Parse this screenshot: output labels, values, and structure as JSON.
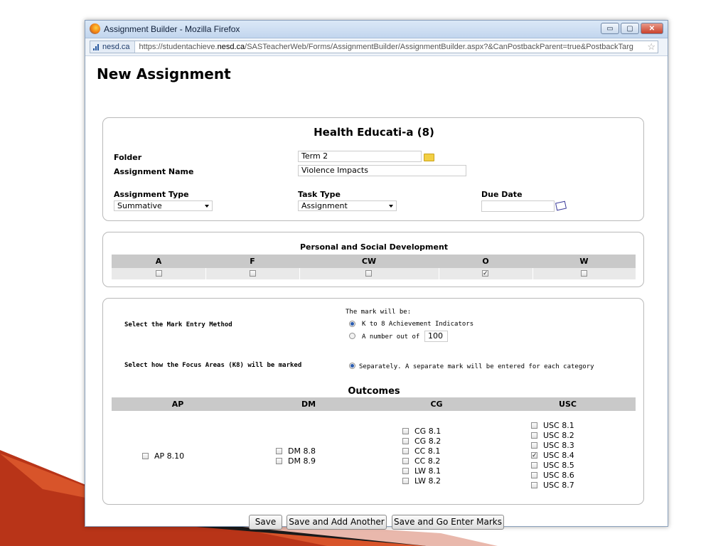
{
  "window": {
    "title": "Assignment Builder - Mozilla Firefox",
    "minimize_label": "▭",
    "maximize_label": "▢",
    "close_label": "✕"
  },
  "urlbar": {
    "site_identity": "nesd.ca",
    "url_prefix": "https://studentachieve.",
    "url_domain": "nesd.ca",
    "url_suffix": "/SASTeacherWeb/Forms/AssignmentBuilder/AssignmentBuilder.aspx?&CanPostbackParent=true&PostbackTarg"
  },
  "page": {
    "title": "New Assignment"
  },
  "details": {
    "course_title": "Health Educati-a (8)",
    "folder_label": "Folder",
    "folder_value": "Term 2",
    "assignment_name_label": "Assignment Name",
    "assignment_name_value": "Violence Impacts",
    "assignment_type_label": "Assignment Type",
    "assignment_type_value": "Summative",
    "task_type_label": "Task Type",
    "task_type_value": "Assignment",
    "due_date_label": "Due Date",
    "due_date_value": ""
  },
  "psd": {
    "title": "Personal and Social Development",
    "columns": [
      {
        "label": "A",
        "checked": false
      },
      {
        "label": "F",
        "checked": false
      },
      {
        "label": "CW",
        "checked": false
      },
      {
        "label": "O",
        "checked": true
      },
      {
        "label": "W",
        "checked": false
      }
    ]
  },
  "marking": {
    "mark_entry_label": "Select the Mark Entry Method",
    "mark_will_be": "The mark will be:",
    "option_k8": "K to 8 Achievement Indicators",
    "option_number": "A number out of",
    "number_out_of": "100",
    "focus_label": "Select how the Focus Areas (K8) will be marked",
    "focus_option": "Separately. A separate mark will be entered for each category"
  },
  "outcomes": {
    "title": "Outcomes",
    "columns": [
      {
        "header": "AP",
        "items": [
          {
            "label": "AP 8.10",
            "checked": false
          }
        ]
      },
      {
        "header": "DM",
        "items": [
          {
            "label": "DM 8.8",
            "checked": false
          },
          {
            "label": "DM 8.9",
            "checked": false
          }
        ]
      },
      {
        "header": "CG",
        "items": [
          {
            "label": "CG 8.1",
            "checked": false
          },
          {
            "label": "CG 8.2",
            "checked": false
          },
          {
            "label": "CC 8.1",
            "checked": false
          },
          {
            "label": "CC 8.2",
            "checked": false
          },
          {
            "label": "LW 8.1",
            "checked": false
          },
          {
            "label": "LW 8.2",
            "checked": false
          }
        ]
      },
      {
        "header": "USC",
        "items": [
          {
            "label": "USC 8.1",
            "checked": false
          },
          {
            "label": "USC 8.2",
            "checked": false
          },
          {
            "label": "USC 8.3",
            "checked": false
          },
          {
            "label": "USC 8.4",
            "checked": true
          },
          {
            "label": "USC 8.5",
            "checked": false
          },
          {
            "label": "USC 8.6",
            "checked": false
          },
          {
            "label": "USC 8.7",
            "checked": false
          }
        ]
      }
    ]
  },
  "buttons": {
    "save": "Save",
    "save_add": "Save and Add Another",
    "save_marks": "Save and Go Enter Marks"
  },
  "icons": {
    "check_glyph": "✓"
  }
}
